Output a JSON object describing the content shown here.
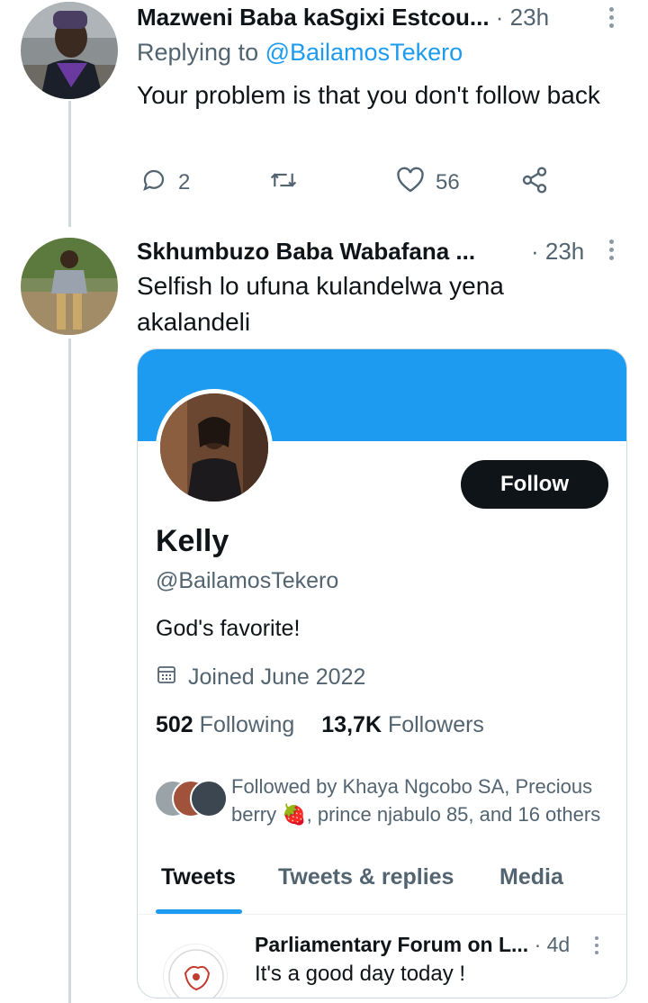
{
  "tweets": [
    {
      "display_name": "Mazweni Baba kaSgixi Estcou...",
      "time": "· 23h",
      "replying_prefix": "Replying to",
      "replying_handle": "@BailamosTekero",
      "text": "Your problem is that you don't follow back",
      "reply_count": "2",
      "retweet_count": "",
      "like_count": "56"
    },
    {
      "display_name": "Skhumbuzo Baba Wabafana ...",
      "time": "· 23h",
      "text": "Selfish lo ufuna kulandelwa yena akalandeli"
    }
  ],
  "profile_card": {
    "follow_label": "Follow",
    "name": "Kelly",
    "handle": "@BailamosTekero",
    "bio": "God's favorite!",
    "joined": "Joined June 2022",
    "following_count": "502",
    "following_label": "Following",
    "followers_count": "13,7K",
    "followers_label": "Followers",
    "followed_by": "Followed by Khaya Ngcobo SA, Precious berry 🍓, prince njabulo 85, and 16 others",
    "tabs": [
      "Tweets",
      "Tweets & replies",
      "Media"
    ],
    "active_tab": "Tweets",
    "latest_tweet": {
      "display_name": "Parliamentary Forum on L...",
      "time": "· 4d",
      "text": "It's a good day today !"
    }
  },
  "colors": {
    "accent": "#1d9bf0",
    "secondary_text": "#536471",
    "primary_text": "#0f1419",
    "follow_button": "#0f1419"
  }
}
